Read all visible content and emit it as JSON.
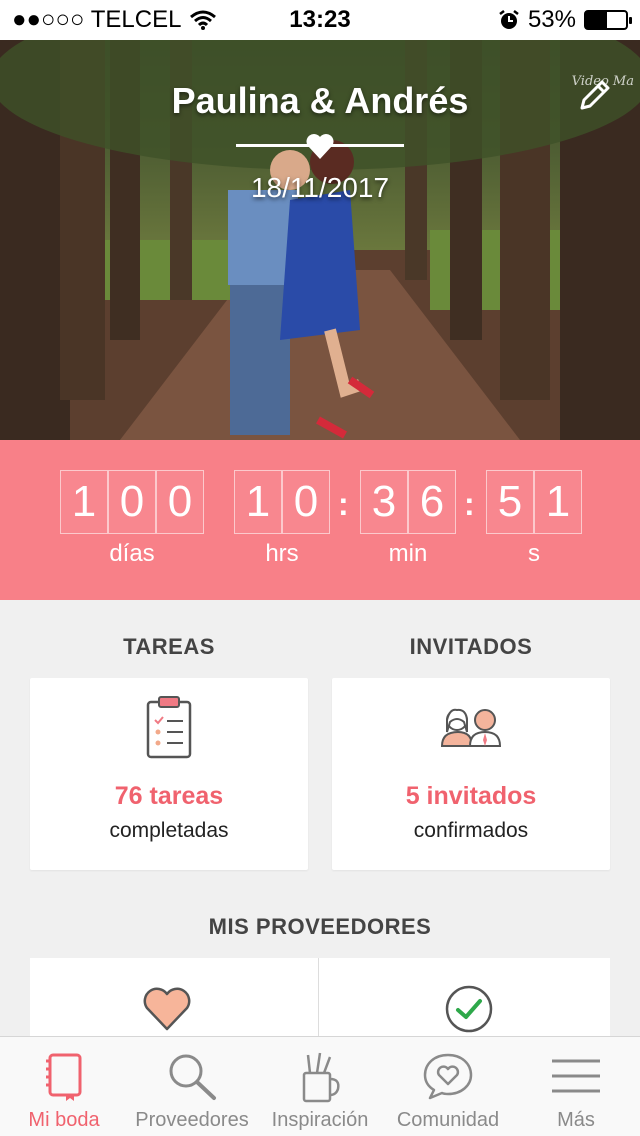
{
  "status_bar": {
    "carrier": "●●○○○ TELCEL",
    "time": "13:23",
    "battery": "53%",
    "battery_level": 0.53
  },
  "hero": {
    "title": "Paulina & Andrés",
    "date": "18/11/2017",
    "watermark": "Video Ma"
  },
  "countdown": {
    "days": [
      "1",
      "0",
      "0"
    ],
    "hours": [
      "1",
      "0"
    ],
    "minutes": [
      "3",
      "6"
    ],
    "seconds": [
      "5",
      "1"
    ],
    "labels": {
      "days": "días",
      "hours": "hrs",
      "minutes": "min",
      "seconds": "s"
    },
    "color": "#f88088"
  },
  "tasks": {
    "title": "TAREAS",
    "value": "76 tareas",
    "sub": "completadas"
  },
  "guests": {
    "title": "INVITADOS",
    "value": "5 invitados",
    "sub": "confirmados"
  },
  "vendors": {
    "title": "MIS PROVEEDORES",
    "icons": [
      "heart-icon",
      "check-circle-icon"
    ]
  },
  "tabs": [
    {
      "label": "Mi boda",
      "icon": "notebook-icon",
      "active": true
    },
    {
      "label": "Proveedores",
      "icon": "search-icon",
      "active": false
    },
    {
      "label": "Inspiración",
      "icon": "pencil-cup-icon",
      "active": false
    },
    {
      "label": "Comunidad",
      "icon": "chat-heart-icon",
      "active": false
    },
    {
      "label": "Más",
      "icon": "menu-icon",
      "active": false
    }
  ],
  "accent_color": "#f0626e"
}
